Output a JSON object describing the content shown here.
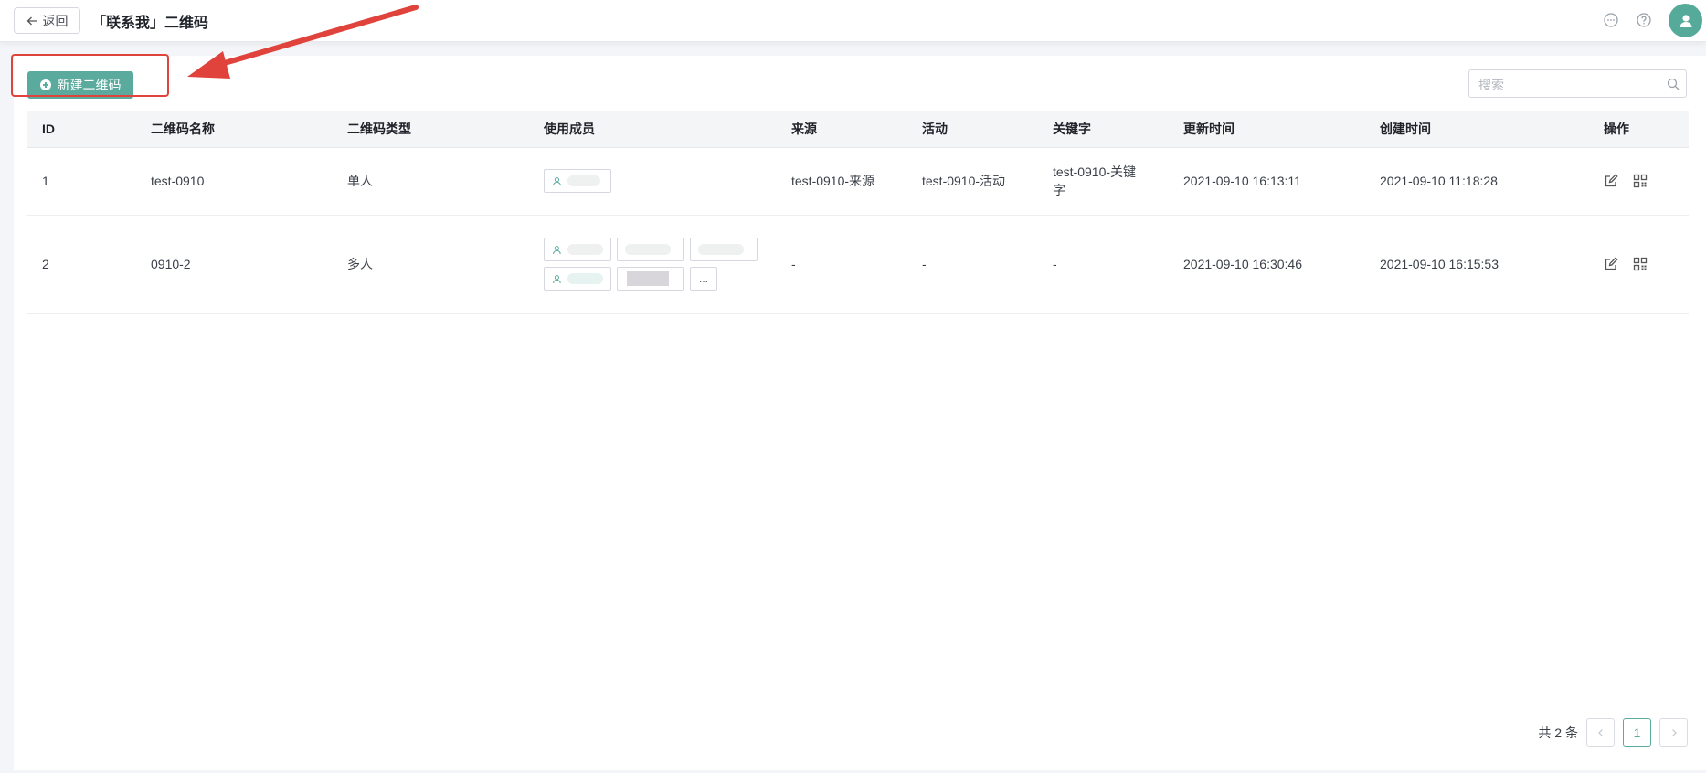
{
  "header": {
    "back_label": "返回",
    "title": "「联系我」二维码",
    "icons": [
      "message-icon",
      "help-icon",
      "user-avatar-icon"
    ]
  },
  "toolbar": {
    "create_label": "新建二维码",
    "search_placeholder": "搜索"
  },
  "table": {
    "columns": [
      "ID",
      "二维码名称",
      "二维码类型",
      "使用成员",
      "来源",
      "活动",
      "关键字",
      "更新时间",
      "创建时间",
      "操作"
    ],
    "rows": [
      {
        "id": "1",
        "name": "test-0910",
        "type": "单人",
        "source": "test-0910-来源",
        "activity": "test-0910-活动",
        "keyword": "test-0910-关键字",
        "updated": "2021-09-10 16:13:11",
        "created": "2021-09-10 11:18:28"
      },
      {
        "id": "2",
        "name": "0910-2",
        "type": "多人",
        "source": "-",
        "activity": "-",
        "keyword": "-",
        "updated": "2021-09-10 16:30:46",
        "created": "2021-09-10 16:15:53",
        "more_label": "..."
      }
    ]
  },
  "pagination": {
    "total_label": "共 2 条",
    "current_page": "1"
  },
  "colors": {
    "accent": "#5aab9e",
    "annotation_red": "#e0433b"
  }
}
